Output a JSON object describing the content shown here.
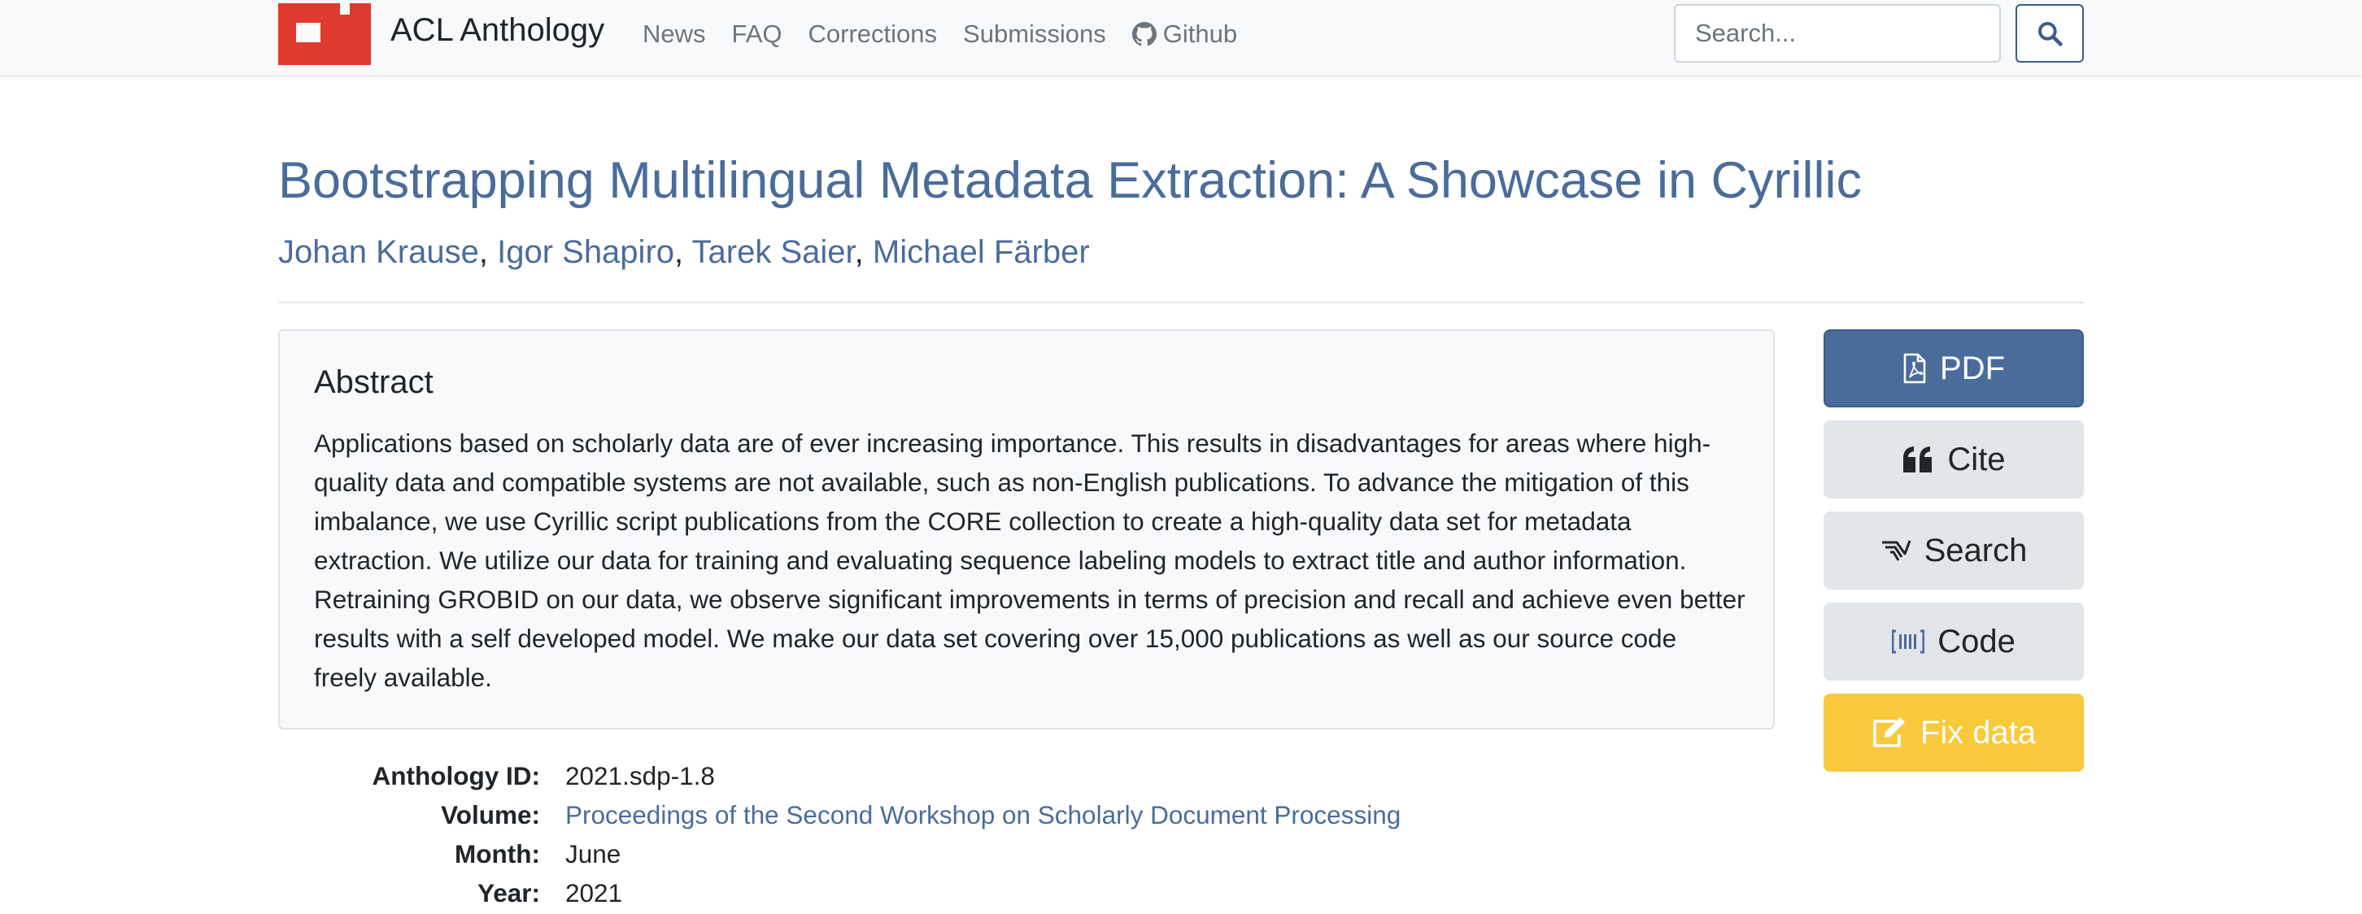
{
  "navbar": {
    "brand": "ACL Anthology",
    "links": [
      "News",
      "FAQ",
      "Corrections",
      "Submissions",
      "Github"
    ],
    "search_placeholder": "Search...",
    "brand_color": "#e03a2e"
  },
  "paper": {
    "title": "Bootstrapping Multilingual Metadata Extraction: A Showcase in Cyrillic",
    "authors": [
      "Johan Krause",
      "Igor Shapiro",
      "Tarek Saier",
      "Michael Färber"
    ],
    "author_separator": ","
  },
  "abstract": {
    "heading": "Abstract",
    "text": "Applications based on scholarly data are of ever increasing importance. This results in disadvantages for areas where high-quality data and compatible systems are not available, such as non-English publications. To advance the mitigation of this imbalance, we use Cyrillic script publications from the CORE collection to create a high-quality data set for metadata extraction. We utilize our data for training and evaluating sequence labeling models to extract title and author information. Retraining GROBID on our data, we observe significant improvements in terms of precision and recall and achieve even better results with a self developed model. We make our data set covering over 15,000 publications as well as our source code freely available."
  },
  "actions": {
    "pdf": "PDF",
    "cite": "Cite",
    "search": "Search",
    "code": "Code",
    "fix": "Fix data"
  },
  "details": [
    {
      "label": "Anthology ID:",
      "value": "2021.sdp-1.8"
    },
    {
      "label": "Volume:",
      "value": "Proceedings of the Second Workshop on Scholarly Document Processing"
    },
    {
      "label": "Month:",
      "value": "June"
    },
    {
      "label": "Year:",
      "value": "2021"
    }
  ],
  "colors": {
    "link": "#4a6c9b",
    "pdf_button": "#4a6c9b",
    "secondary_button": "#e2e5e9",
    "warning_button": "#f8c93b"
  }
}
